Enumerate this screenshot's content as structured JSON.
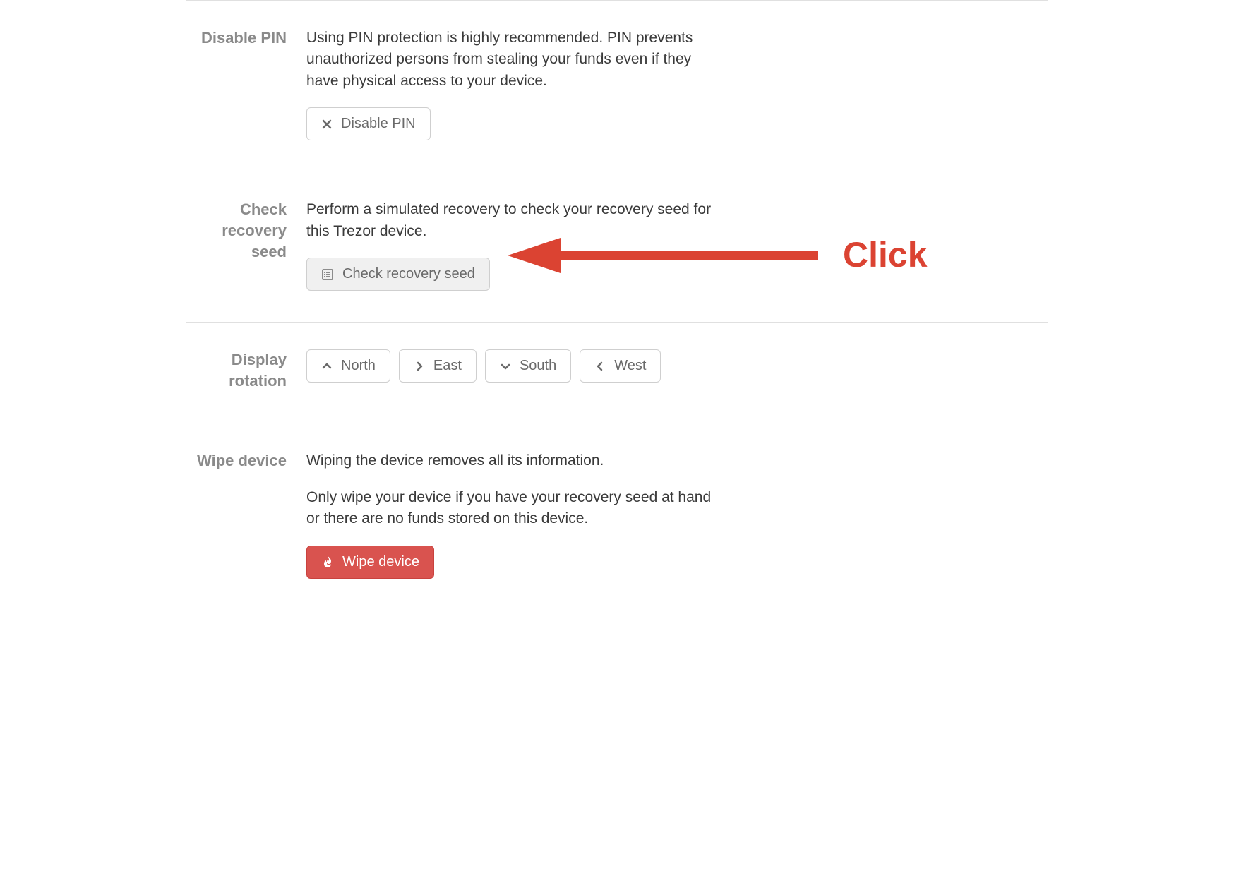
{
  "sections": {
    "disable_pin": {
      "label": "Disable PIN",
      "description": "Using PIN protection is highly recommended. PIN prevents unauthorized persons from stealing your funds even if they have physical access to your device.",
      "button_label": "Disable PIN"
    },
    "check_recovery": {
      "label": "Check recovery seed",
      "description": "Perform a simulated recovery to check your recovery seed for this Trezor device.",
      "button_label": "Check recovery seed"
    },
    "display_rotation": {
      "label": "Display rotation",
      "buttons": {
        "north": "North",
        "east": "East",
        "south": "South",
        "west": "West"
      }
    },
    "wipe_device": {
      "label": "Wipe device",
      "description1": "Wiping the device removes all its information.",
      "description2": "Only wipe your device if you have your recovery seed at hand or there are no funds stored on this device.",
      "button_label": "Wipe device"
    }
  },
  "annotation": {
    "label": "Click",
    "color": "#db4332"
  }
}
